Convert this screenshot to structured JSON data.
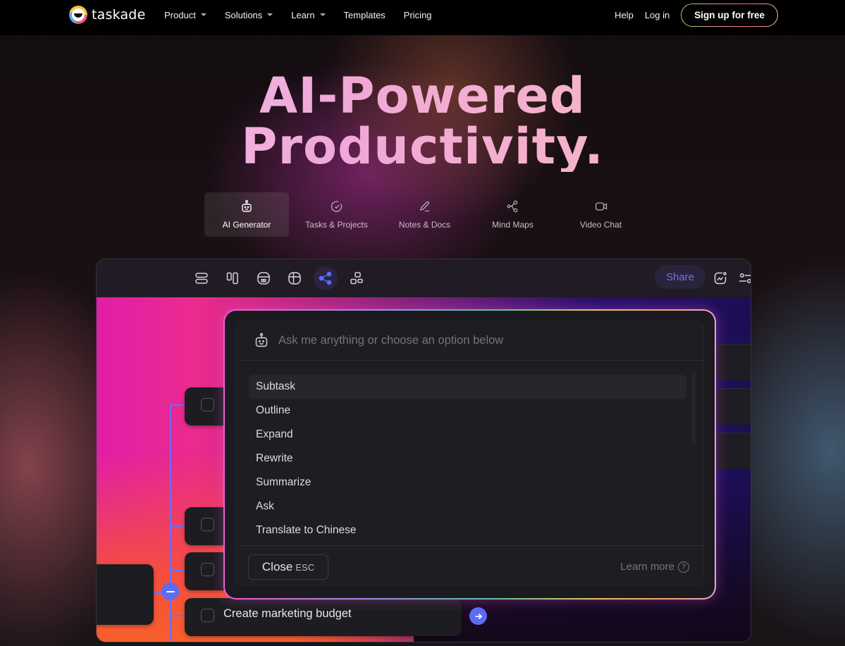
{
  "brand": {
    "name": "taskade"
  },
  "nav": {
    "links": [
      {
        "label": "Product",
        "dropdown": true
      },
      {
        "label": "Solutions",
        "dropdown": true
      },
      {
        "label": "Learn",
        "dropdown": true
      },
      {
        "label": "Templates",
        "dropdown": false
      },
      {
        "label": "Pricing",
        "dropdown": false
      }
    ],
    "help": "Help",
    "login": "Log in",
    "signup": "Sign up for free"
  },
  "hero": {
    "line1": "AI-Powered",
    "line2": "Productivity."
  },
  "tabs": [
    {
      "label": "AI Generator",
      "icon": "robot-icon",
      "active": true
    },
    {
      "label": "Tasks & Projects",
      "icon": "check-circle-icon",
      "active": false
    },
    {
      "label": "Notes & Docs",
      "icon": "pencil-icon",
      "active": false
    },
    {
      "label": "Mind Maps",
      "icon": "mindmap-icon",
      "active": false
    },
    {
      "label": "Video Chat",
      "icon": "video-icon",
      "active": false
    }
  ],
  "app": {
    "toolbar": {
      "views": [
        "list-view-icon",
        "board-view-icon",
        "calendar-view-icon",
        "table-view-icon",
        "mindmap-view-icon",
        "org-chart-view-icon"
      ],
      "active_view": "mindmap-view-icon",
      "share": "Share",
      "extra_icons": [
        "activity-icon",
        "settings-sliders-icon"
      ]
    },
    "ai_dialog": {
      "placeholder": "Ask me anything or choose an option below",
      "options": [
        "Subtask",
        "Outline",
        "Expand",
        "Rewrite",
        "Summarize",
        "Ask",
        "Translate to Chinese"
      ],
      "highlighted": "Subtask",
      "close_label": "Close",
      "close_shortcut": "ESC",
      "learn_more": "Learn more"
    },
    "nodes": {
      "visible_task": "Create marketing budget"
    },
    "colors": {
      "accent": "#5b6cf5",
      "share_text": "#6b72f0"
    }
  }
}
